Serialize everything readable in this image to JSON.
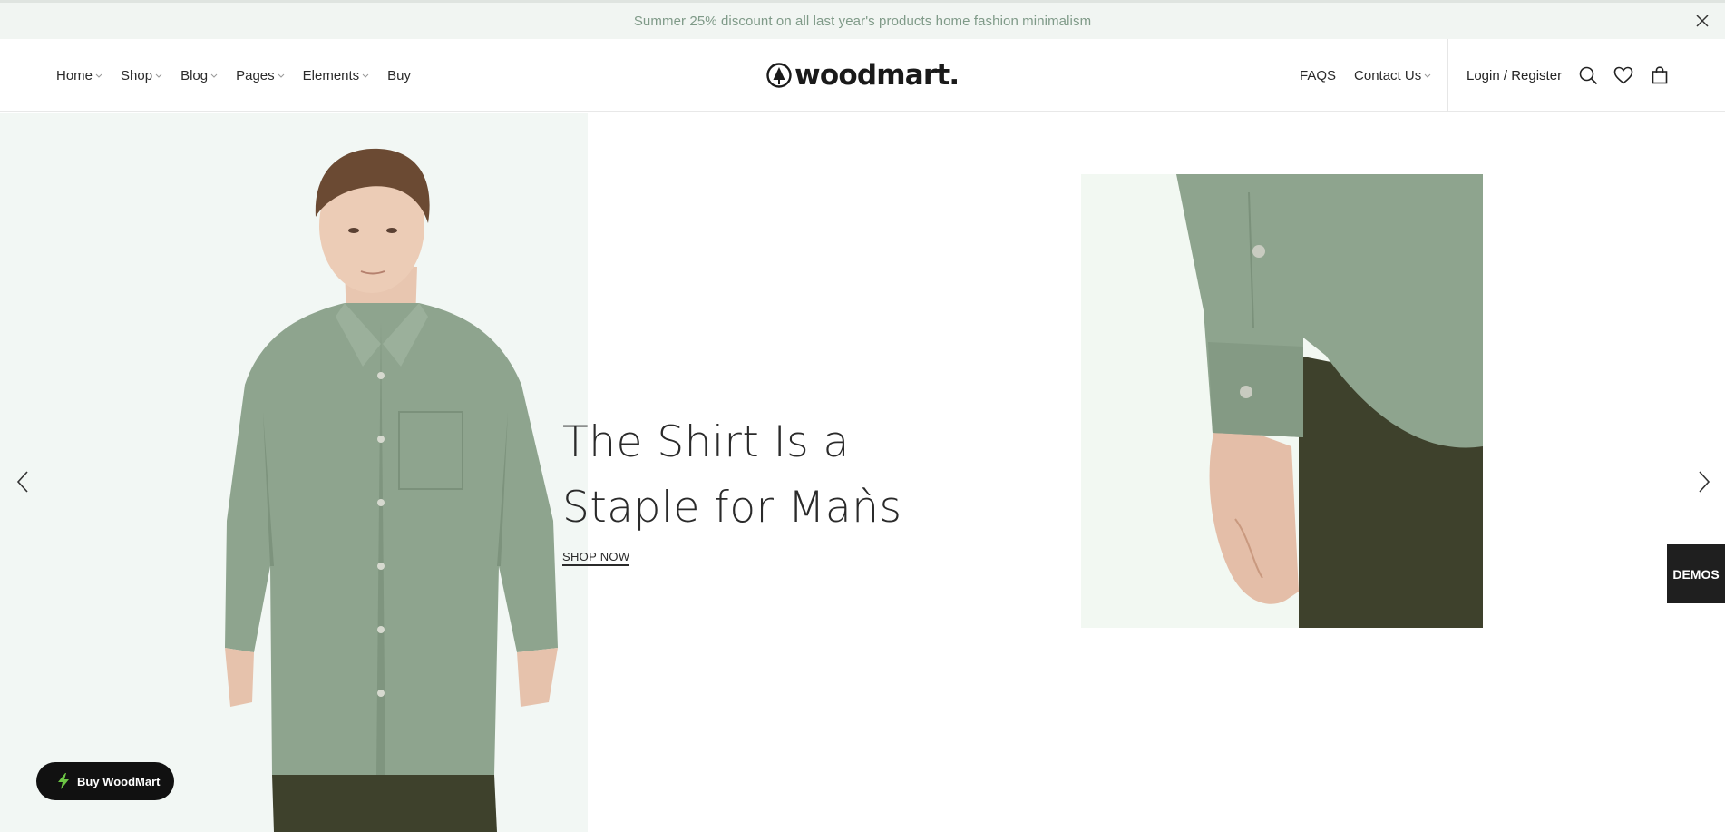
{
  "topbar": {
    "message": "Summer 25% discount on all last year's products home fashion minimalism",
    "close_icon": "close-icon"
  },
  "header": {
    "nav_left": [
      {
        "label": "Home",
        "has_dropdown": true
      },
      {
        "label": "Shop",
        "has_dropdown": true
      },
      {
        "label": "Blog",
        "has_dropdown": true
      },
      {
        "label": "Pages",
        "has_dropdown": true
      },
      {
        "label": "Elements",
        "has_dropdown": true
      },
      {
        "label": "Buy",
        "has_dropdown": false
      }
    ],
    "logo_text": "woodmart.",
    "nav_right": [
      {
        "label": "FAQS",
        "has_dropdown": false
      },
      {
        "label": "Contact Us",
        "has_dropdown": true
      }
    ],
    "login_label": "Login / Register",
    "icons": [
      "search-icon",
      "heart-icon",
      "shopping-bag-icon"
    ]
  },
  "hero": {
    "title_line1": "The Shirt Is a",
    "title_line2": "Staple for Maǹs",
    "cta_label": "SHOP NOW",
    "prev_icon": "chevron-left-icon",
    "next_icon": "chevron-right-icon"
  },
  "demos_label": "DEMOS",
  "buy_button_label": "Buy WoodMart",
  "colors": {
    "accent_green": "#7f9a88",
    "shirt_green": "#8ea48e",
    "pants_olive": "#3e412c",
    "hero_left_bg": "#f2f7f4",
    "dark": "#111111"
  }
}
